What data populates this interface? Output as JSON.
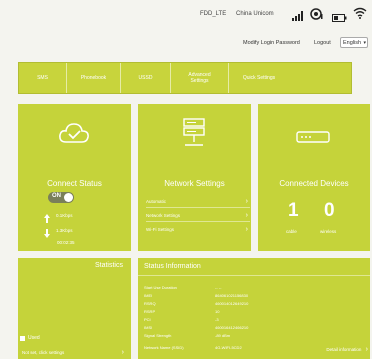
{
  "topbar": {
    "network_type": "FDD_LTE",
    "carrier": "China Unicom",
    "modify_password": "Modify Login Password",
    "logout": "Logout",
    "language": "English"
  },
  "nav": {
    "items": [
      {
        "label": "SMS"
      },
      {
        "label": "Phonebook"
      },
      {
        "label": "USSD"
      },
      {
        "label": "Advanced Settings"
      },
      {
        "label": "Quick Settings"
      }
    ]
  },
  "connect": {
    "title": "Connect Status",
    "toggle_label": "ON",
    "upload_rate": "0.1Kbps",
    "download_rate": "1.3Kbps",
    "duration": "00:02:35"
  },
  "network": {
    "title": "Network Settings",
    "links": [
      {
        "label": "Automatic"
      },
      {
        "label": "Network Settings"
      },
      {
        "label": "Wi-Fi Settings"
      }
    ]
  },
  "devices": {
    "title": "Connected Devices",
    "cable_count": "1",
    "cable_label": "cable",
    "wireless_count": "0",
    "wireless_label": "wireless"
  },
  "statistics": {
    "title": "Statistics",
    "used_label": "Used",
    "link_label": "Not set, click settings"
  },
  "status": {
    "title": "Status Information",
    "rows": [
      {
        "label": "Start Use Duration",
        "value": "-- --"
      },
      {
        "label": "IMEI",
        "value": "864061021156830"
      },
      {
        "label": "RSRQ",
        "value": "460014012649210"
      },
      {
        "label": "RSRP",
        "value": "10"
      },
      {
        "label": "PCI",
        "value": "-3"
      },
      {
        "label": "IMSI",
        "value": "460016412466210"
      },
      {
        "label": "Signal Strength",
        "value": "-89 dBm"
      },
      {
        "label": "Network Name (SSID)",
        "value": "4G-WIFI-5CD2"
      }
    ],
    "detail_link": "Detail information"
  },
  "colors": {
    "accent": "#c5d33a",
    "background": "#f4f4ef"
  }
}
